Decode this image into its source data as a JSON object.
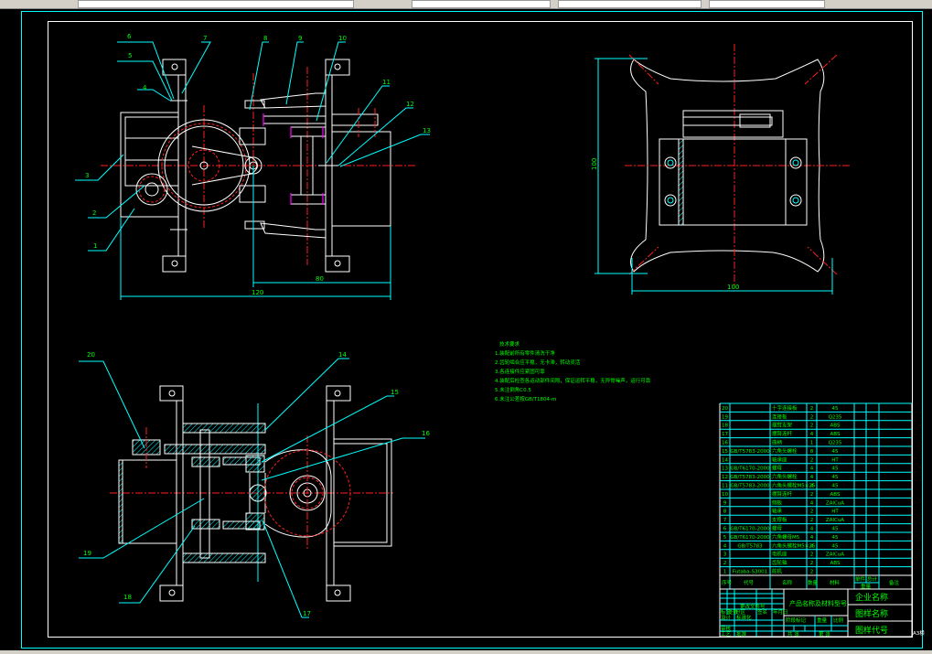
{
  "balloons": {
    "top_view": [
      "6",
      "5",
      "4",
      "7",
      "8",
      "9",
      "10",
      "11",
      "12",
      "13",
      "3",
      "2",
      "1"
    ],
    "bottom_view": [
      "20",
      "14",
      "15",
      "16",
      "19",
      "18",
      "17"
    ]
  },
  "dimensions": {
    "top_view_short": "80",
    "top_view_overall": "120",
    "side_view_height": "100",
    "side_view_width": "100"
  },
  "notes": {
    "title": "技术要求",
    "items": [
      "1.装配前所有零件清洗干净",
      "2.齿轮啮合应平稳，无卡滞，转动灵活",
      "3.各连接件应紧固可靠",
      "4.装配后检查各运动部件间隙，保证运转平稳，无异常噪声，运行可靠",
      "5.未注倒角C0.5",
      "6.未注公差按GB/T1804-m"
    ]
  },
  "parts_table": {
    "rows": [
      {
        "no": "20",
        "code": "",
        "name": "十字连接板",
        "qty": "2",
        "material": "45"
      },
      {
        "no": "19",
        "code": "",
        "name": "连接板",
        "qty": "2",
        "material": "Q235"
      },
      {
        "no": "18",
        "code": "",
        "name": "摆臂支架",
        "qty": "2",
        "material": "ABS"
      },
      {
        "no": "17",
        "code": "",
        "name": "摆臂连杆",
        "qty": "4",
        "material": "ABS"
      },
      {
        "no": "16",
        "code": "",
        "name": "曲柄",
        "qty": "1",
        "material": "Q235"
      },
      {
        "no": "15",
        "code": "GB/T5783-2000",
        "name": "六角头螺栓",
        "qty": "8",
        "material": "45"
      },
      {
        "no": "14",
        "code": "",
        "name": "轴承座",
        "qty": "2",
        "material": "HT"
      },
      {
        "no": "13",
        "code": "GB/T6170-2000",
        "name": "螺母",
        "qty": "4",
        "material": "45"
      },
      {
        "no": "12",
        "code": "GB/T5783-2000",
        "name": "六角头螺栓",
        "qty": "4",
        "material": "45"
      },
      {
        "no": "11",
        "code": "GB/T5783-2000",
        "name": "六角头螺栓M5×25",
        "qty": "4",
        "material": "45"
      },
      {
        "no": "10",
        "code": "",
        "name": "摆臂连杆",
        "qty": "2",
        "material": "ABS"
      },
      {
        "no": "9",
        "code": "",
        "name": "侧板",
        "qty": "4",
        "material": "ZAlCuA"
      },
      {
        "no": "8",
        "code": "",
        "name": "轴承",
        "qty": "2",
        "material": "HT"
      },
      {
        "no": "7",
        "code": "",
        "name": "支撑板",
        "qty": "2",
        "material": "ZAlCuA"
      },
      {
        "no": "6",
        "code": "GB/T6170-2000",
        "name": "螺母",
        "qty": "4",
        "material": "45"
      },
      {
        "no": "5",
        "code": "GB/T6170-2000",
        "name": "六角螺母M5",
        "qty": "4",
        "material": "45"
      },
      {
        "no": "4",
        "code": "GB/T5783",
        "name": "六角头螺栓M5×25",
        "qty": "4",
        "material": "45"
      },
      {
        "no": "3",
        "code": "",
        "name": "电机座",
        "qty": "2",
        "material": "ZAlCuA"
      },
      {
        "no": "2",
        "code": "",
        "name": "齿轮轴",
        "qty": "2",
        "material": "ABS"
      },
      {
        "no": "1",
        "code": "Futaba-S3001",
        "name": "舵机",
        "qty": "2",
        "material": ""
      }
    ],
    "header": {
      "no": "序号",
      "code": "代号",
      "name": "名称",
      "qty": "数量",
      "material": "材料",
      "single": "单件",
      "total": "总计",
      "weight": "重量",
      "remark": "备注"
    }
  },
  "title_block": {
    "product_name": "产品名称及材料型号",
    "company": "企业名称",
    "drawing_name": "图样名称",
    "drawing_code": "图样代号",
    "labels": [
      "标记",
      "处数",
      "分区",
      "更改文件号",
      "签名",
      "年月日",
      "设计",
      "标准化",
      "阶段标记",
      "重量",
      "比例",
      "审核",
      "工艺",
      "批准",
      "共 张",
      "第 张"
    ]
  },
  "sheet_tag": "A3横",
  "colors": {
    "background": "#000000",
    "outline": "#ffffff",
    "leader": "#00ffff",
    "center": "#ff2020",
    "text": "#00ff00",
    "hidden": "#ff00ff"
  }
}
